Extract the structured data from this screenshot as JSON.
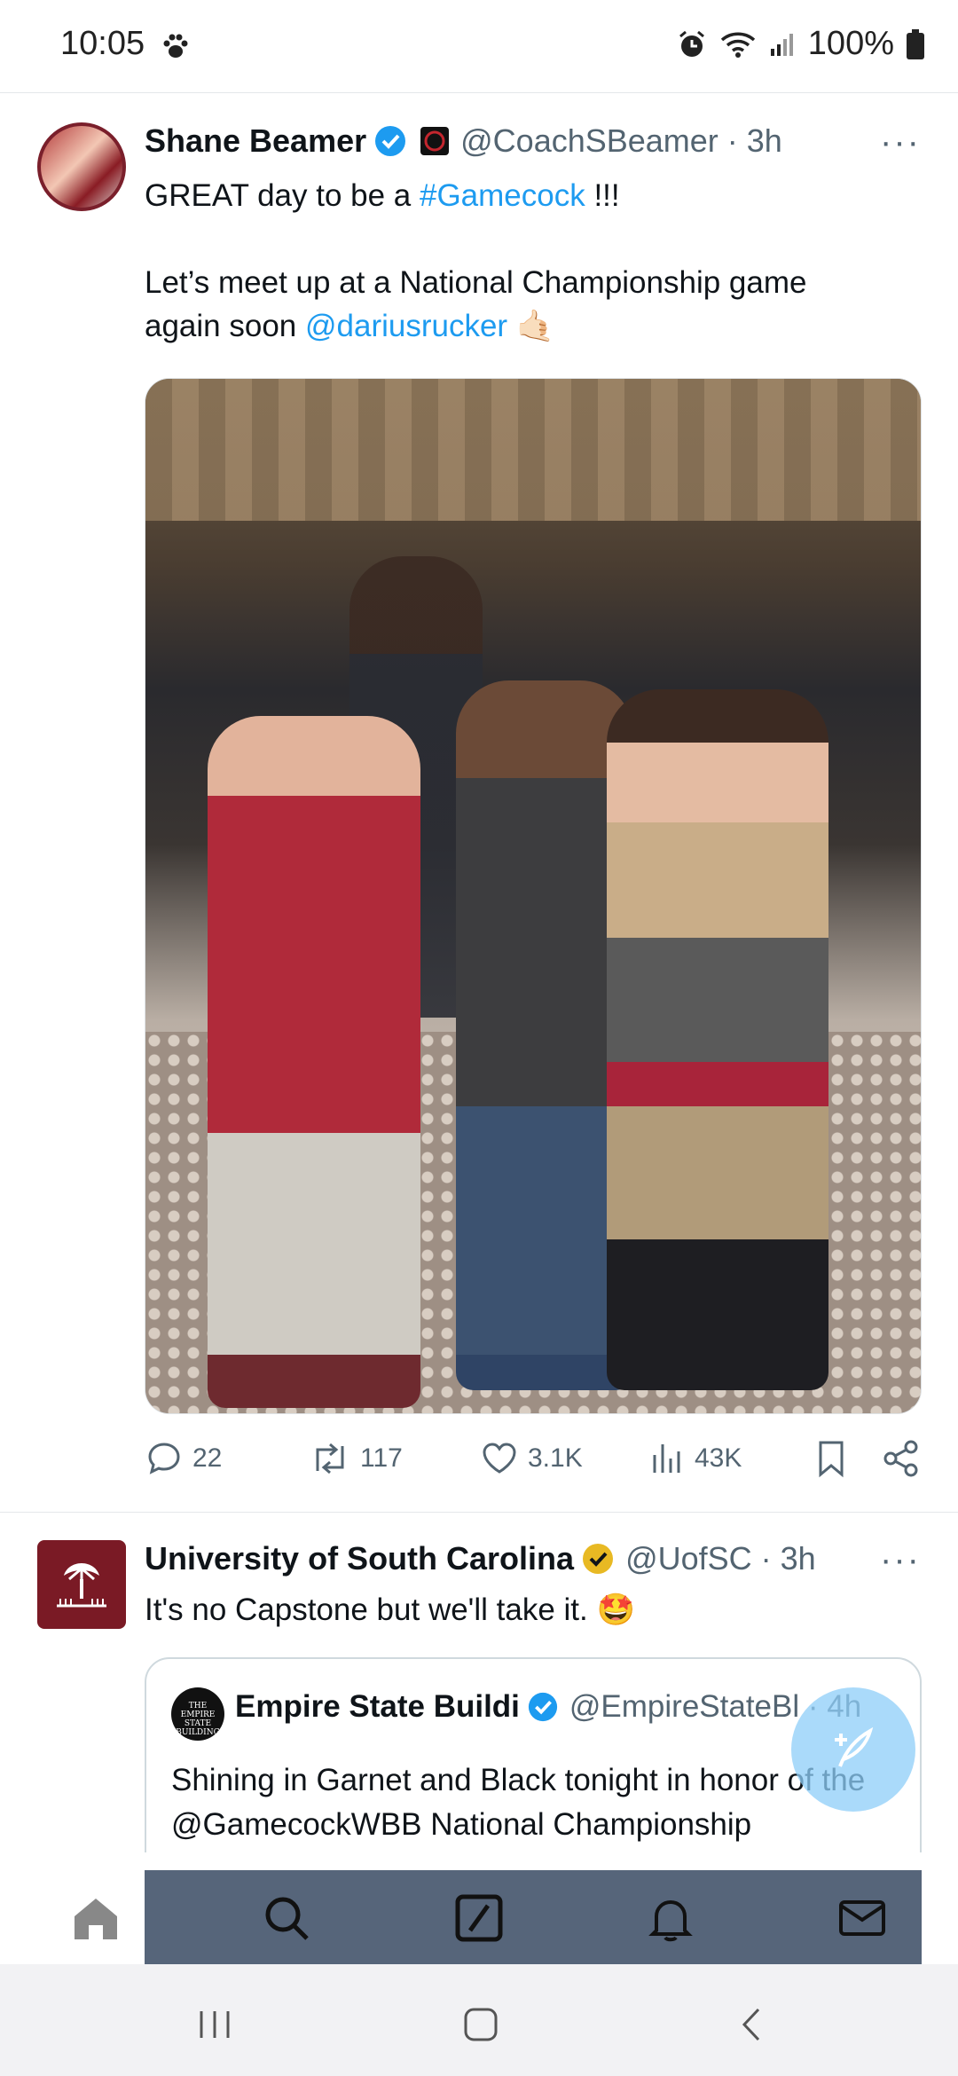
{
  "status_bar": {
    "time": "10:05",
    "battery": "100%",
    "icons": [
      "paw-icon",
      "alarm-icon",
      "wifi-icon",
      "signal-icon",
      "battery-icon"
    ]
  },
  "tweet1": {
    "name": "Shane Beamer",
    "handle_time": "@CoachSBeamer · 3h",
    "text_line1_pre": "GREAT day to be a ",
    "text_line1_hashtag": "#Gamecock",
    "text_line1_post": " !!!",
    "text_line2": "Let’s meet up at a National Championship game",
    "text_line3_pre": "again soon ",
    "text_line3_mention": "@dariusrucker",
    "text_line3_emoji": "🤙🏻",
    "replies": "22",
    "retweets": "117",
    "likes": "3.1K",
    "views": "43K",
    "more": "···"
  },
  "tweet2": {
    "name": "University of South Carolina",
    "handle_time": "@UofSC · 3h",
    "text": "It's no Capstone but we'll take it.",
    "emoji": "🤩",
    "more": "···",
    "quote": {
      "avatar_text": "THE EMPIRE STATE BUILDING",
      "name": "Empire State Buildi",
      "handle_time": "@EmpireStateBl · 4h",
      "text": "Shining in Garnet and Black tonight in honor of the @GamecockWBB National Championship"
    }
  },
  "colors": {
    "accent": "#1d9bf0",
    "text": "#0f1419",
    "muted": "#536471",
    "verified_gold": "#e8b923",
    "garnet": "#7a1a25"
  }
}
